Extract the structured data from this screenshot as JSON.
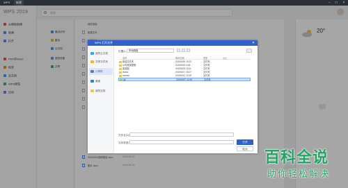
{
  "titlebar": {
    "tab_home": "WPS",
    "tab_new": "新建"
  },
  "leftnav": {
    "logo": "WPS 2019",
    "items": [
      {
        "label": "从模板新建",
        "color": "#e7503b"
      },
      {
        "label": "新建",
        "color": "#4a8cf0"
      },
      {
        "label": "打开",
        "color": "#4a8cf0"
      },
      {
        "label": "PDF转Word",
        "color": "#e7503b"
      },
      {
        "label": "稻壳",
        "color": "#e88a1a"
      },
      {
        "label": "云文档",
        "color": "#38a3f0"
      },
      {
        "label": "WPS便签",
        "color": "#3bb35f"
      },
      {
        "label": "应用",
        "color": "#8b6cf0"
      }
    ]
  },
  "search": {
    "placeholder": "搜索"
  },
  "col2": {
    "items": [
      "最近访问",
      "星标",
      "云文档",
      "我的设备",
      "共享"
    ]
  },
  "filelist": {
    "top": "我的电脑",
    "files": [
      "新建文本",
      "新建文档",
      "新建文档",
      "新建文档",
      "新建文档",
      "文件",
      "文件",
      "文件",
      "文件",
      "文件"
    ]
  },
  "bottom_files": [
    {
      "name": "20190520调研报告.docx",
      "date": "2019-05-20"
    },
    {
      "name": "图片.docx",
      "date": "2019-05-20"
    }
  ],
  "weather": {
    "temp": "20°"
  },
  "dialog": {
    "title": "WPS 打开文件",
    "close": "✕",
    "sidebar": [
      {
        "label": "我的云文档",
        "active": false
      },
      {
        "label": "共享文件夹",
        "active": false
      },
      {
        "label": "计算机",
        "active": true
      },
      {
        "label": "桌面",
        "active": false
      },
      {
        "label": "我的文档",
        "active": false
      }
    ],
    "location_label": "位置(I):",
    "location_value": "本地磁盘",
    "headers": {
      "name": "名称",
      "date": "修改日期",
      "type": "类型",
      "size": "大小"
    },
    "rows": [
      {
        "name": "新建文件夹",
        "date": "2019/5/29 15:22",
        "type": "文件夹",
        "kind": "folder"
      },
      {
        "name": "公司资源整理",
        "date": "2019/5/16 9:06",
        "type": "文件夹",
        "kind": "folder"
      },
      {
        "name": "旅游图",
        "date": "2019/5/23 13:11",
        "type": "文件夹",
        "kind": "folder"
      },
      {
        "name": "music",
        "date": "2019/5/17 15:27",
        "type": "文件夹",
        "kind": "folder"
      },
      {
        "name": "movies",
        "date": "2019/6/12 13:19",
        "type": "文件夹",
        "kind": "folder"
      },
      {
        "name": "gif",
        "date": "2019/5/27 11:08",
        "type": "文件夹",
        "kind": "gif"
      }
    ],
    "filename_label": "文件名(N):",
    "filetype_label": "文件类型(T):",
    "open_button": "打开",
    "cancel_button": "取消"
  },
  "watermark": {
    "line1": "百科全说",
    "line2": "助你轻松解决"
  }
}
